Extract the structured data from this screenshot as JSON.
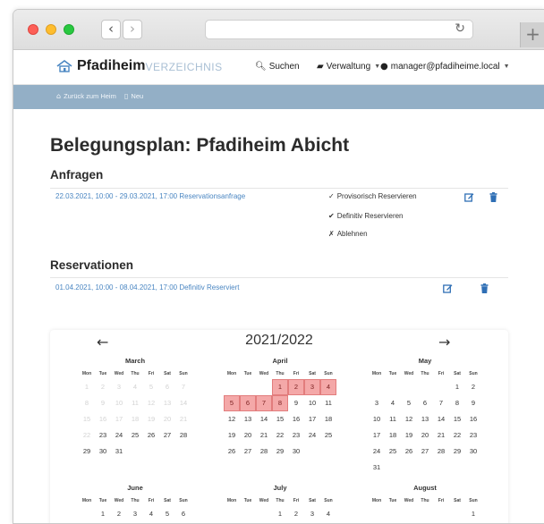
{
  "browser": {
    "back_glyph": "‹",
    "forward_glyph": "›",
    "reload_glyph": "↻",
    "newtab_glyph": "+"
  },
  "navbar": {
    "brand": "Pfadiheim",
    "brand_suffix": "VERZEICHNIS",
    "search": "Suchen",
    "admin": "Verwaltung",
    "user": "manager@pfadiheime.local"
  },
  "subnav": {
    "back": "Zurück zum Heim",
    "new": "Neu"
  },
  "page": {
    "title": "Belegungsplan: Pfadiheim Abicht"
  },
  "anfragen": {
    "title": "Anfragen",
    "rows": [
      {
        "text": "22.03.2021, 10:00 - 29.03.2021, 17:00 Reservationsanfrage",
        "options": [
          {
            "icon": "✓",
            "label": "Provisorisch Reservieren"
          },
          {
            "icon": "✔",
            "label": "Definitiv Reservieren"
          },
          {
            "icon": "✗",
            "label": "Ablehnen"
          }
        ]
      }
    ]
  },
  "reservationen": {
    "title": "Reservationen",
    "rows": [
      {
        "text": "01.04.2021, 10:00 - 08.04.2021, 17:00 Definitiv Reserviert"
      }
    ]
  },
  "calendar": {
    "prev": "←",
    "next": "→",
    "year_label": "2021/2022",
    "weekdays": [
      "Mon",
      "Tue",
      "Wed",
      "Thu",
      "Fri",
      "Sat",
      "Sun"
    ],
    "months": [
      {
        "name": "March",
        "weeks": [
          [
            {
              "d": "1",
              "s": "muted"
            },
            {
              "d": "2",
              "s": "muted"
            },
            {
              "d": "3",
              "s": "muted"
            },
            {
              "d": "4",
              "s": "muted"
            },
            {
              "d": "5",
              "s": "muted"
            },
            {
              "d": "6",
              "s": "muted"
            },
            {
              "d": "7",
              "s": "muted"
            }
          ],
          [
            {
              "d": "8",
              "s": "muted"
            },
            {
              "d": "9",
              "s": "muted"
            },
            {
              "d": "10",
              "s": "muted"
            },
            {
              "d": "11",
              "s": "muted"
            },
            {
              "d": "12",
              "s": "muted"
            },
            {
              "d": "13",
              "s": "muted"
            },
            {
              "d": "14",
              "s": "muted"
            }
          ],
          [
            {
              "d": "15",
              "s": "muted"
            },
            {
              "d": "16",
              "s": "muted"
            },
            {
              "d": "17",
              "s": "muted"
            },
            {
              "d": "18",
              "s": "muted"
            },
            {
              "d": "19",
              "s": "muted"
            },
            {
              "d": "20",
              "s": "muted"
            },
            {
              "d": "21",
              "s": "muted"
            }
          ],
          [
            {
              "d": "22",
              "s": "muted"
            },
            {
              "d": "23",
              "s": ""
            },
            {
              "d": "24",
              "s": ""
            },
            {
              "d": "25",
              "s": ""
            },
            {
              "d": "26",
              "s": ""
            },
            {
              "d": "27",
              "s": ""
            },
            {
              "d": "28",
              "s": ""
            }
          ],
          [
            {
              "d": "29",
              "s": ""
            },
            {
              "d": "30",
              "s": ""
            },
            {
              "d": "31",
              "s": ""
            },
            {
              "d": "",
              "s": ""
            },
            {
              "d": "",
              "s": ""
            },
            {
              "d": "",
              "s": ""
            },
            {
              "d": "",
              "s": ""
            }
          ]
        ]
      },
      {
        "name": "April",
        "weeks": [
          [
            {
              "d": "",
              "s": ""
            },
            {
              "d": "",
              "s": ""
            },
            {
              "d": "",
              "s": ""
            },
            {
              "d": "1",
              "s": "booked"
            },
            {
              "d": "2",
              "s": "booked"
            },
            {
              "d": "3",
              "s": "booked"
            },
            {
              "d": "4",
              "s": "booked"
            }
          ],
          [
            {
              "d": "5",
              "s": "booked"
            },
            {
              "d": "6",
              "s": "booked"
            },
            {
              "d": "7",
              "s": "booked"
            },
            {
              "d": "8",
              "s": "booked"
            },
            {
              "d": "9",
              "s": ""
            },
            {
              "d": "10",
              "s": ""
            },
            {
              "d": "11",
              "s": ""
            }
          ],
          [
            {
              "d": "12",
              "s": ""
            },
            {
              "d": "13",
              "s": ""
            },
            {
              "d": "14",
              "s": ""
            },
            {
              "d": "15",
              "s": ""
            },
            {
              "d": "16",
              "s": ""
            },
            {
              "d": "17",
              "s": ""
            },
            {
              "d": "18",
              "s": ""
            }
          ],
          [
            {
              "d": "19",
              "s": ""
            },
            {
              "d": "20",
              "s": ""
            },
            {
              "d": "21",
              "s": ""
            },
            {
              "d": "22",
              "s": ""
            },
            {
              "d": "23",
              "s": ""
            },
            {
              "d": "24",
              "s": ""
            },
            {
              "d": "25",
              "s": ""
            }
          ],
          [
            {
              "d": "26",
              "s": ""
            },
            {
              "d": "27",
              "s": ""
            },
            {
              "d": "28",
              "s": ""
            },
            {
              "d": "29",
              "s": ""
            },
            {
              "d": "30",
              "s": ""
            },
            {
              "d": "",
              "s": ""
            },
            {
              "d": "",
              "s": ""
            }
          ]
        ]
      },
      {
        "name": "May",
        "weeks": [
          [
            {
              "d": "",
              "s": ""
            },
            {
              "d": "",
              "s": ""
            },
            {
              "d": "",
              "s": ""
            },
            {
              "d": "",
              "s": ""
            },
            {
              "d": "",
              "s": ""
            },
            {
              "d": "1",
              "s": ""
            },
            {
              "d": "2",
              "s": ""
            }
          ],
          [
            {
              "d": "3",
              "s": ""
            },
            {
              "d": "4",
              "s": ""
            },
            {
              "d": "5",
              "s": ""
            },
            {
              "d": "6",
              "s": ""
            },
            {
              "d": "7",
              "s": ""
            },
            {
              "d": "8",
              "s": ""
            },
            {
              "d": "9",
              "s": ""
            }
          ],
          [
            {
              "d": "10",
              "s": ""
            },
            {
              "d": "11",
              "s": ""
            },
            {
              "d": "12",
              "s": ""
            },
            {
              "d": "13",
              "s": ""
            },
            {
              "d": "14",
              "s": ""
            },
            {
              "d": "15",
              "s": ""
            },
            {
              "d": "16",
              "s": ""
            }
          ],
          [
            {
              "d": "17",
              "s": ""
            },
            {
              "d": "18",
              "s": ""
            },
            {
              "d": "19",
              "s": ""
            },
            {
              "d": "20",
              "s": ""
            },
            {
              "d": "21",
              "s": ""
            },
            {
              "d": "22",
              "s": ""
            },
            {
              "d": "23",
              "s": ""
            }
          ],
          [
            {
              "d": "24",
              "s": ""
            },
            {
              "d": "25",
              "s": ""
            },
            {
              "d": "26",
              "s": ""
            },
            {
              "d": "27",
              "s": ""
            },
            {
              "d": "28",
              "s": ""
            },
            {
              "d": "29",
              "s": ""
            },
            {
              "d": "30",
              "s": ""
            }
          ],
          [
            {
              "d": "31",
              "s": ""
            },
            {
              "d": "",
              "s": ""
            },
            {
              "d": "",
              "s": ""
            },
            {
              "d": "",
              "s": ""
            },
            {
              "d": "",
              "s": ""
            },
            {
              "d": "",
              "s": ""
            },
            {
              "d": "",
              "s": ""
            }
          ]
        ]
      },
      {
        "name": "June",
        "weeks": [
          [
            {
              "d": "",
              "s": ""
            },
            {
              "d": "1",
              "s": ""
            },
            {
              "d": "2",
              "s": ""
            },
            {
              "d": "3",
              "s": ""
            },
            {
              "d": "4",
              "s": ""
            },
            {
              "d": "5",
              "s": ""
            },
            {
              "d": "6",
              "s": ""
            }
          ]
        ]
      },
      {
        "name": "July",
        "weeks": [
          [
            {
              "d": "",
              "s": ""
            },
            {
              "d": "",
              "s": ""
            },
            {
              "d": "",
              "s": ""
            },
            {
              "d": "1",
              "s": ""
            },
            {
              "d": "2",
              "s": ""
            },
            {
              "d": "3",
              "s": ""
            },
            {
              "d": "4",
              "s": ""
            }
          ]
        ]
      },
      {
        "name": "August",
        "weeks": [
          [
            {
              "d": "",
              "s": ""
            },
            {
              "d": "",
              "s": ""
            },
            {
              "d": "",
              "s": ""
            },
            {
              "d": "",
              "s": ""
            },
            {
              "d": "",
              "s": ""
            },
            {
              "d": "",
              "s": ""
            },
            {
              "d": "1",
              "s": ""
            }
          ]
        ]
      }
    ]
  },
  "colors": {
    "subnav_bg": "#93afc6",
    "link": "#4a86c2",
    "action_icon": "#2f6fb5",
    "booked_bg": "#f4a8a8"
  }
}
